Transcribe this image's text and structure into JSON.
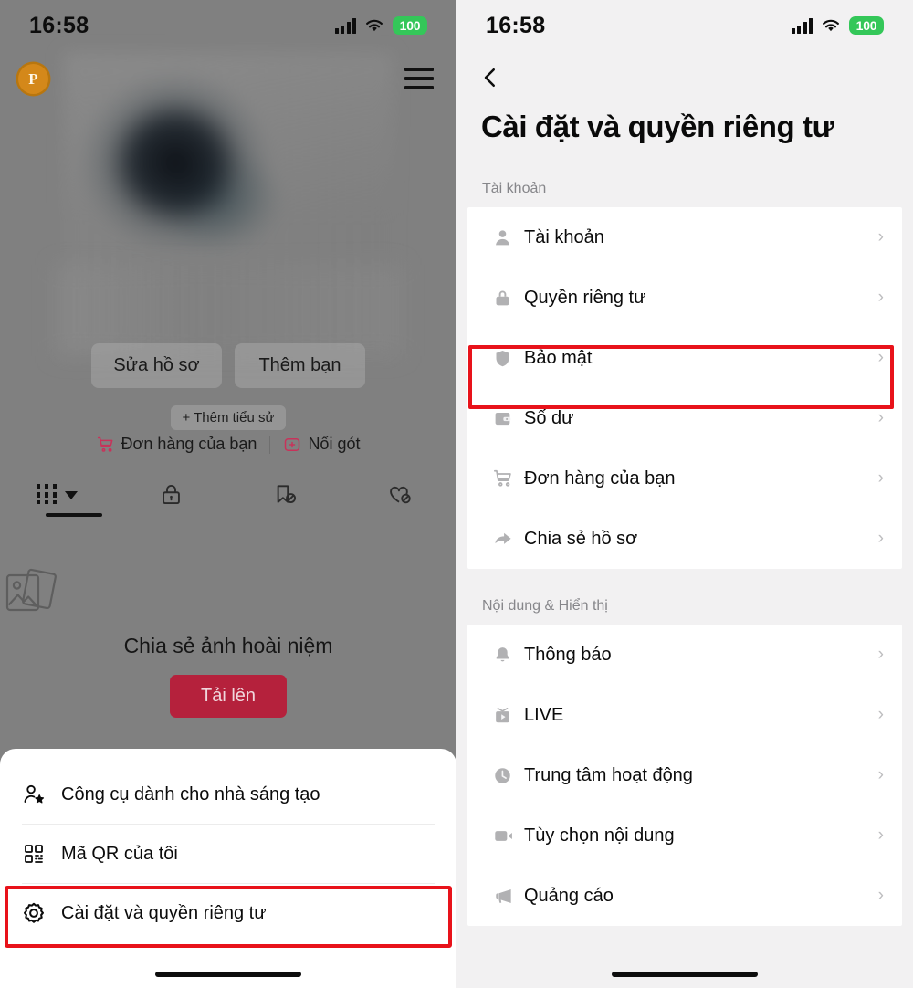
{
  "status_bar": {
    "time": "16:58",
    "battery": "100",
    "cell_icon": "cellular-signal-icon",
    "wifi_icon": "wifi-icon"
  },
  "left_panel": {
    "avatar_badge": "P",
    "menu_icon": "hamburger-menu-icon",
    "buttons": [
      {
        "label": "Sửa hồ sơ",
        "name": "edit-profile-button"
      },
      {
        "label": "Thêm bạn",
        "name": "add-friend-button"
      }
    ],
    "add_bio": "+ Thêm tiểu sử",
    "links": [
      {
        "label": "Đơn hàng của bạn",
        "icon": "cart-icon"
      },
      {
        "label": "Nối gót",
        "icon": "add-box-icon"
      }
    ],
    "tabs": [
      {
        "icon": "grid-icon",
        "active": true
      },
      {
        "icon": "lock-icon",
        "active": false
      },
      {
        "icon": "bookmark-off-icon",
        "active": false
      },
      {
        "icon": "heart-off-icon",
        "active": false
      }
    ],
    "empty_state": {
      "icon": "photos-icon",
      "title": "Chia sẻ ảnh hoài niệm",
      "button": "Tải lên"
    },
    "sheet": {
      "items": [
        {
          "label": "Công cụ dành cho nhà sáng tạo",
          "icon": "creator-tools-icon",
          "highlighted": false
        },
        {
          "label": "Mã QR của tôi",
          "icon": "qr-code-icon",
          "highlighted": false
        },
        {
          "label": "Cài đặt và quyền riêng tư",
          "icon": "gear-icon",
          "highlighted": true
        }
      ]
    }
  },
  "right_panel": {
    "back_icon": "chevron-left-icon",
    "title": "Cài đặt và quyền riêng tư",
    "sections": [
      {
        "label": "Tài khoản",
        "items": [
          {
            "label": "Tài khoản",
            "icon": "person-icon",
            "highlighted": false
          },
          {
            "label": "Quyền riêng tư",
            "icon": "lock-icon",
            "highlighted": false
          },
          {
            "label": "Bảo mật",
            "icon": "shield-icon",
            "highlighted": true
          },
          {
            "label": "Số dư",
            "icon": "wallet-icon",
            "highlighted": false
          },
          {
            "label": "Đơn hàng của bạn",
            "icon": "cart-icon",
            "highlighted": false
          },
          {
            "label": "Chia sẻ hồ sơ",
            "icon": "share-arrow-icon",
            "highlighted": false
          }
        ]
      },
      {
        "label": "Nội dung & Hiển thị",
        "items": [
          {
            "label": "Thông báo",
            "icon": "bell-icon",
            "highlighted": false
          },
          {
            "label": "LIVE",
            "icon": "live-tv-icon",
            "highlighted": false
          },
          {
            "label": "Trung tâm hoạt động",
            "icon": "clock-icon",
            "highlighted": false
          },
          {
            "label": "Tùy chọn nội dung",
            "icon": "video-camera-icon",
            "highlighted": false
          },
          {
            "label": "Quảng cáo",
            "icon": "megaphone-icon",
            "highlighted": false
          }
        ]
      }
    ],
    "chevron": "›"
  },
  "colors": {
    "highlight_red": "#e8121a",
    "upload_red": "#b5213c",
    "battery_green": "#34c759",
    "link_red": "#c8325a"
  }
}
